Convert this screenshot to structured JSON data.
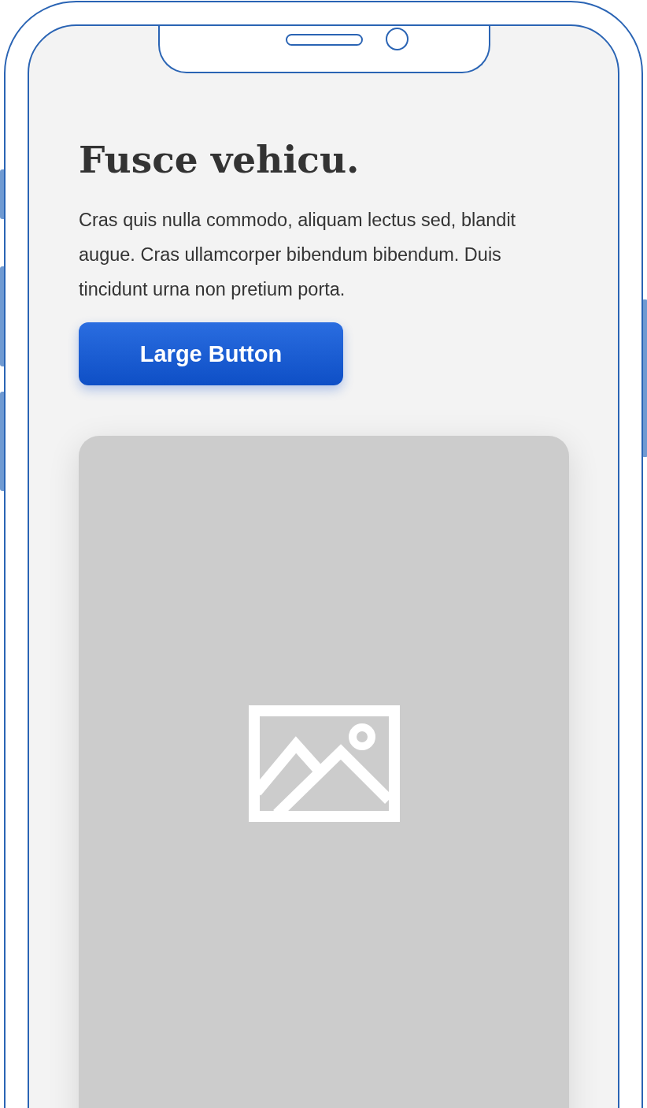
{
  "heading": "Fusce vehicu.",
  "body": "Cras quis nulla commodo, aliquam lectus sed, blandit augue. Cras ullamcorper bibendum bibendum. Duis tincidunt urna non pretium porta.",
  "button": {
    "label": "Large Button"
  }
}
